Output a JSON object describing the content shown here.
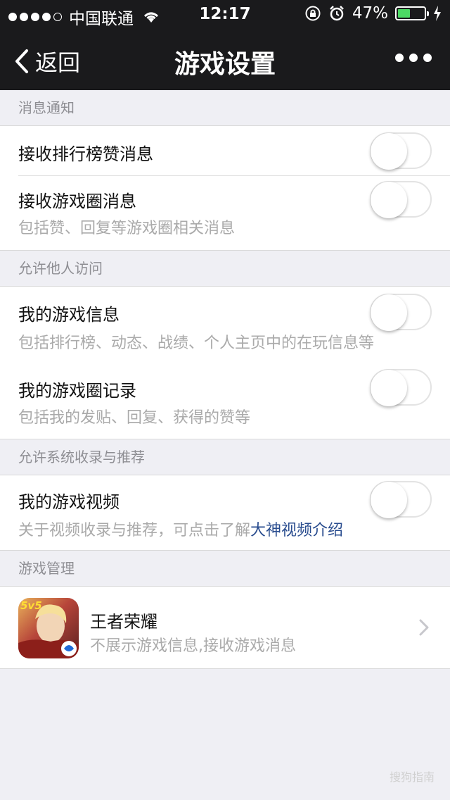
{
  "status_bar": {
    "carrier": "中国联通",
    "time": "12:17",
    "battery_percent": "47%",
    "battery_level": 0.47,
    "signal_dots": 5,
    "signal_filled": 4,
    "icons": [
      "wifi-icon",
      "rotation-lock-icon",
      "alarm-icon",
      "battery-icon",
      "charging-icon"
    ]
  },
  "nav": {
    "back_label": "返回",
    "title": "游戏设置"
  },
  "sections": {
    "notifications": {
      "header": "消息通知",
      "items": [
        {
          "title": "接收排行榜赞消息",
          "subtitle": "",
          "enabled": false
        },
        {
          "title": "接收游戏圈消息",
          "subtitle": "包括赞、回复等游戏圈相关消息",
          "enabled": false
        }
      ]
    },
    "visitors": {
      "header": "允许他人访问",
      "items": [
        {
          "title": "我的游戏信息",
          "subtitle": "包括排行榜、动态、战绩、个人主页中的在玩信息等",
          "enabled": false
        },
        {
          "title": "我的游戏圈记录",
          "subtitle": "包括我的发贴、回复、获得的赞等",
          "enabled": false
        }
      ]
    },
    "system": {
      "header": "允许系统收录与推荐",
      "items": [
        {
          "title": "我的游戏视频",
          "subtitle_prefix": "关于视频收录与推荐，可点击了解",
          "subtitle_link": "大神视频介绍",
          "enabled": false
        }
      ]
    },
    "games": {
      "header": "游戏管理",
      "items": [
        {
          "name": "王者荣耀",
          "subtitle": "不展示游戏信息,接收游戏消息",
          "icon_badge": "5v5"
        }
      ]
    }
  },
  "watermark": "搜狗指南",
  "colors": {
    "bar_bg": "#1a1a1c",
    "page_bg": "#efeff4",
    "link": "#2a4d8f",
    "battery_fill": "#4cd964"
  }
}
